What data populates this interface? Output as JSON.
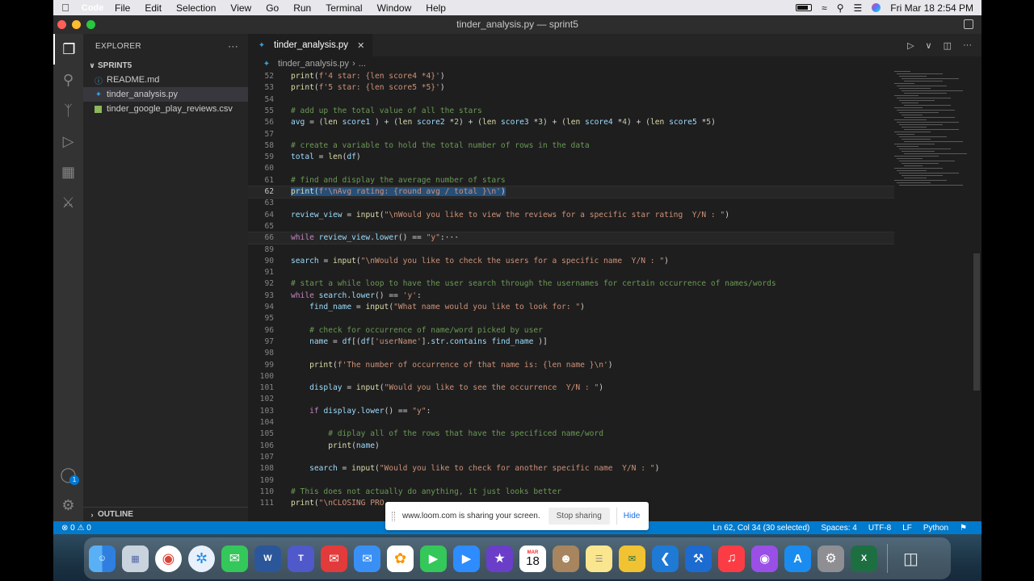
{
  "menubar": {
    "app_name": "Code",
    "menus": [
      "File",
      "Edit",
      "Selection",
      "View",
      "Go",
      "Run",
      "Terminal",
      "Window",
      "Help"
    ],
    "clock": "Fri Mar 18  2:54 PM"
  },
  "window": {
    "title": "tinder_analysis.py — sprint5"
  },
  "explorer": {
    "header": "EXPLORER",
    "folder": "SPRINT5",
    "files": [
      {
        "name": "README.md",
        "icon": "info-icon"
      },
      {
        "name": "tinder_analysis.py",
        "icon": "python-icon"
      },
      {
        "name": "tinder_google_play_reviews.csv",
        "icon": "csv-icon"
      }
    ],
    "outline": "OUTLINE"
  },
  "tab": {
    "label": "tinder_analysis.py"
  },
  "breadcrumb": {
    "file": "tinder_analysis.py",
    "rest": "..."
  },
  "code_lines": [
    {
      "n": "52",
      "text": "print(f'4 star: {len score4 *4}')"
    },
    {
      "n": "53",
      "text": "print(f'5 star: {len score5 *5}')"
    },
    {
      "n": "54",
      "text": ""
    },
    {
      "n": "55",
      "text": "# add up the total value of all the stars"
    },
    {
      "n": "56",
      "text": "avg = (len score1 ) + (len score2 *2) + (len score3 *3) + (len score4 *4) + (len score5 *5)"
    },
    {
      "n": "57",
      "text": ""
    },
    {
      "n": "58",
      "text": "# create a variable to hold the total number of rows in the data"
    },
    {
      "n": "59",
      "text": "total = len(df)"
    },
    {
      "n": "60",
      "text": ""
    },
    {
      "n": "61",
      "text": "# find and display the average number of stars"
    },
    {
      "n": "62",
      "text": "print(f'\\nAvg rating: {round avg / total }\\n')"
    },
    {
      "n": "63",
      "text": ""
    },
    {
      "n": "64",
      "text": "review_view = input(\"\\nWould you like to view the reviews for a specific star rating  Y/N : \")"
    },
    {
      "n": "65",
      "text": ""
    },
    {
      "n": "66",
      "text": "while review_view.lower() == \"y\":···"
    },
    {
      "n": "89",
      "text": ""
    },
    {
      "n": "90",
      "text": "search = input(\"\\nWould you like to check the users for a specific name  Y/N : \")"
    },
    {
      "n": "91",
      "text": ""
    },
    {
      "n": "92",
      "text": "# start a while loop to have the user search through the usernames for certain occurrence of names/words"
    },
    {
      "n": "93",
      "text": "while search.lower() == 'y':"
    },
    {
      "n": "94",
      "text": "    find_name = input(\"What name would you like to look for: \")"
    },
    {
      "n": "95",
      "text": ""
    },
    {
      "n": "96",
      "text": "    # check for occurrence of name/word picked by user"
    },
    {
      "n": "97",
      "text": "    name = df[(df['userName'].str.contains find_name )]"
    },
    {
      "n": "98",
      "text": ""
    },
    {
      "n": "99",
      "text": "    print(f'The number of occurrence of that name is: {len name }\\n')"
    },
    {
      "n": "100",
      "text": ""
    },
    {
      "n": "101",
      "text": "    display = input(\"Would you like to see the occurrence  Y/N : \")"
    },
    {
      "n": "102",
      "text": ""
    },
    {
      "n": "103",
      "text": "    if display.lower() == \"y\":"
    },
    {
      "n": "104",
      "text": ""
    },
    {
      "n": "105",
      "text": "        # diplay all of the rows that have the specificed name/word"
    },
    {
      "n": "106",
      "text": "        print(name)"
    },
    {
      "n": "107",
      "text": ""
    },
    {
      "n": "108",
      "text": "    search = input(\"Would you like to check for another specific name  Y/N : \")"
    },
    {
      "n": "109",
      "text": ""
    },
    {
      "n": "110",
      "text": "# This does not actually do anything, it just looks better"
    },
    {
      "n": "111",
      "text": "print(\"\\nCLOSING PRO"
    }
  ],
  "statusbar": {
    "errors": "⊗ 0 ⚠ 0",
    "position": "Ln 62, Col 34 (30 selected)",
    "spaces": "Spaces: 4",
    "encoding": "UTF-8",
    "eol": "LF",
    "language": "Python"
  },
  "loom": {
    "message": "www.loom.com is sharing your screen.",
    "stop": "Stop sharing",
    "hide": "Hide"
  },
  "dock": {
    "apps": [
      "Finder",
      "Launchpad",
      "Chrome",
      "Safari",
      "Messages",
      "Word",
      "Teams",
      "Mail Alt",
      "Mail",
      "Photos",
      "FaceTime",
      "Zoom",
      "iMovie",
      "Calendar",
      "Contacts",
      "Notes",
      "Excel Alt",
      "VS Code",
      "Xcode",
      "Music",
      "Podcasts",
      "App Store",
      "System Preferences",
      "Excel",
      "Trash"
    ],
    "calendar": {
      "month": "MAR",
      "day": "18"
    }
  },
  "colors": {
    "accent": "#007acc",
    "comment": "#6a9955",
    "keyword": "#c586c0",
    "string": "#ce9178"
  }
}
